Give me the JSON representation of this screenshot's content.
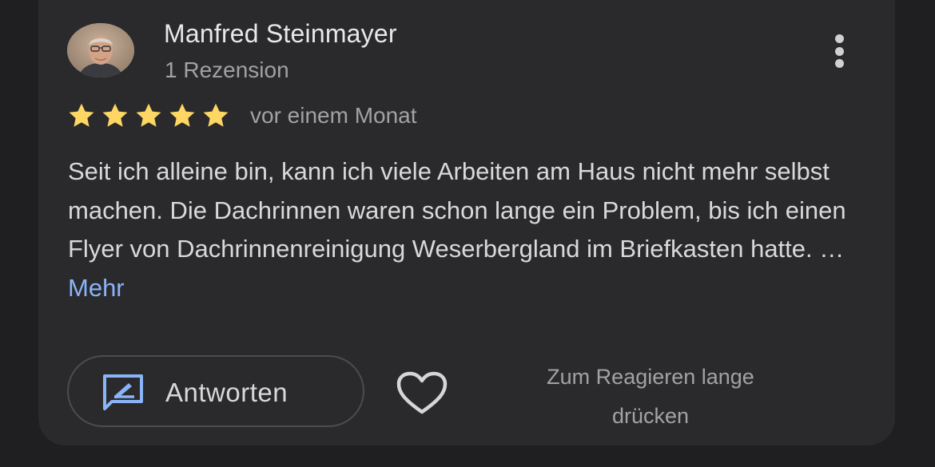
{
  "review": {
    "author_name": "Manfred Steinmayer",
    "review_count": "1 Rezension",
    "rating": 5,
    "rating_max": 5,
    "time": "vor einem Monat",
    "text": "Seit ich alleine bin, kann ich viele Arbeiten am Haus nicht mehr selbst machen. Die Dachrinnen waren schon lange ein Problem, bis ich einen Flyer von Dachrinnenreinigung Weserbergland im Briefkasten hatte.",
    "ellipsis": "…",
    "more_label": "Mehr"
  },
  "actions": {
    "reply_label": "Antworten",
    "reply_icon": "reply-icon",
    "like_icon": "heart-icon",
    "menu_icon": "more-vert-icon",
    "hint_line1": "Zum Reagieren lange",
    "hint_line2": "drücken"
  },
  "colors": {
    "background": "#1f1f21",
    "card": "#2a2a2c",
    "star": "#fdd663",
    "link": "#8ab4f8",
    "reply_icon": "#8ab4f8"
  }
}
